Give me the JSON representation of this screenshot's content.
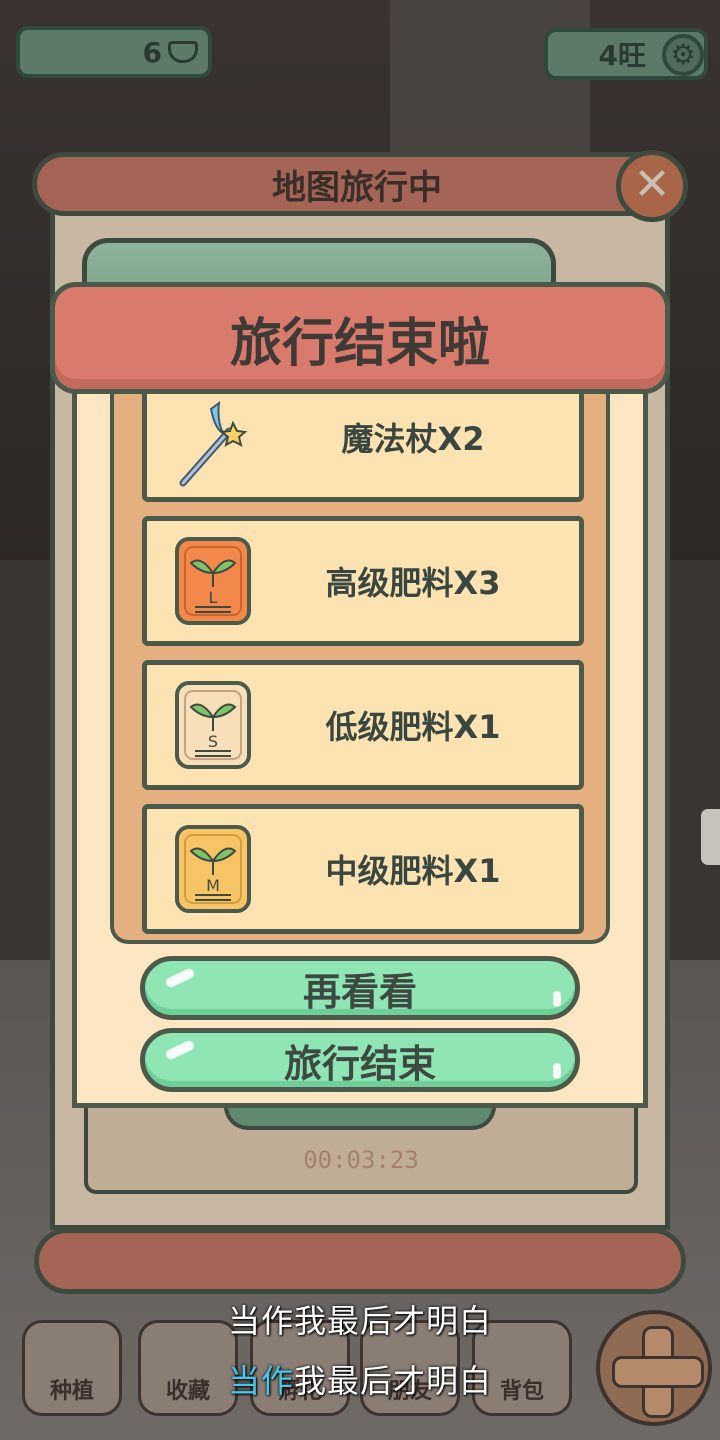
{
  "hud": {
    "coins": "6",
    "wang": "4旺"
  },
  "bottom_nav": {
    "items": [
      {
        "label": "种植"
      },
      {
        "label": "收藏"
      },
      {
        "label": "孵化"
      },
      {
        "label": "朋友"
      },
      {
        "label": "背包"
      }
    ]
  },
  "map_panel": {
    "title": "地图旅行中",
    "timer": "00:03:23"
  },
  "modal": {
    "title": "旅行结束啦",
    "rewards": [
      {
        "label": "魔法杖X2",
        "icon": "magic-wand-icon"
      },
      {
        "label": "高级肥料X3",
        "icon": "fertilizer-bag-L-icon",
        "bag_color": "#f2894a",
        "letter": "L"
      },
      {
        "label": "低级肥料X1",
        "icon": "fertilizer-bag-S-icon",
        "bag_color": "#f6dfb9",
        "letter": "S"
      },
      {
        "label": "中级肥料X1",
        "icon": "fertilizer-bag-M-icon",
        "bag_color": "#f8c566",
        "letter": "M"
      }
    ],
    "buttons": {
      "look_again": "再看看",
      "end_travel": "旅行结束"
    }
  },
  "lyrics": {
    "line1": "当作我最后才明白",
    "line2_highlight": "当作",
    "line2_rest": "我最后才明白"
  },
  "colors": {
    "banner": "#d97b6c",
    "button_green": "#8fe6b4",
    "lyric_highlight": "#43c8ee"
  }
}
